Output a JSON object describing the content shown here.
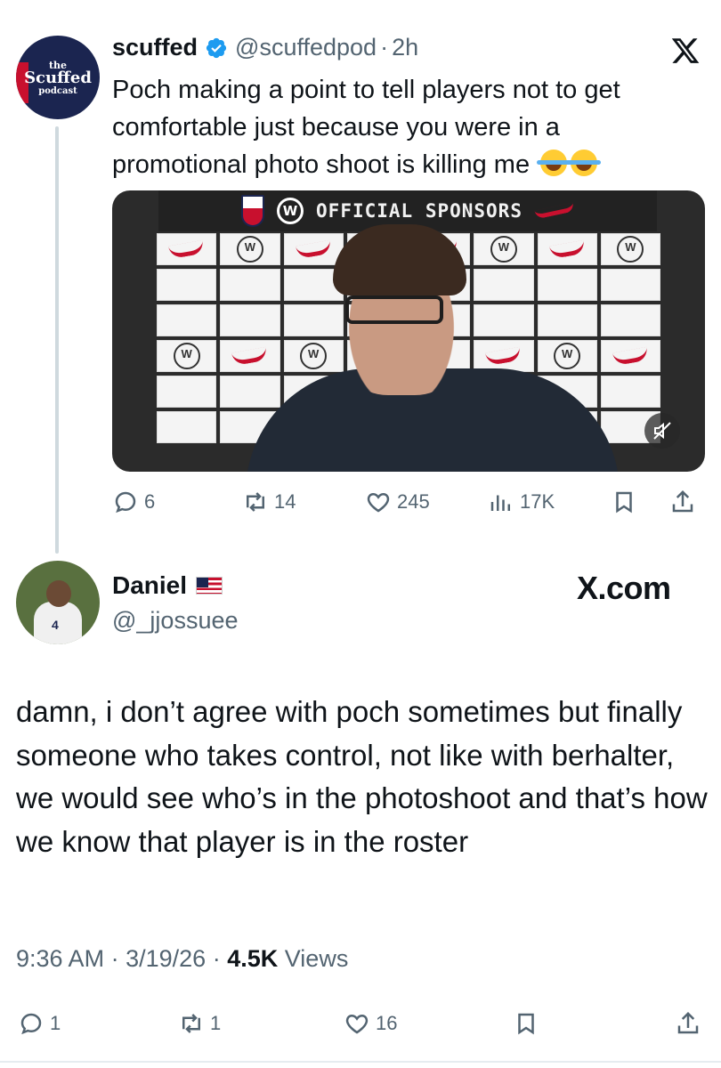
{
  "quoted": {
    "avatar_text": [
      "the",
      "Scuffed",
      "podcast"
    ],
    "name": "scuffed",
    "handle": "@scuffedpod",
    "dot": "·",
    "time": "2h",
    "text": "Poch making a point to tell players not to get comfortable just because you were in a promotional photo shoot is killing me",
    "emoji": [
      "face-with-tears-of-joy",
      "face-with-tears-of-joy"
    ],
    "media": {
      "sponsor_title": "OFFICIAL SPONSORS",
      "vw": "W"
    },
    "stats": {
      "replies": "6",
      "reposts": "14",
      "likes": "245",
      "views": "17K"
    }
  },
  "reply": {
    "name": "Daniel",
    "flag": "us-flag",
    "handle": "@_jjossuee",
    "watermark": "X.com",
    "avatar_jersey_number": "4",
    "text": "damn, i don’t agree with poch sometimes but finally someone who takes control, not like with berhalter, we would see who’s in the photoshoot and that’s how we know that player is in the roster",
    "time": "9:36 AM",
    "dot": "·",
    "date": "3/19/26",
    "views_count": "4.5K",
    "views_label": "Views",
    "stats": {
      "replies": "1",
      "reposts": "1",
      "likes": "16"
    }
  },
  "colors": {
    "text": "#0f1419",
    "muted": "#536471",
    "verified": "#1d9bf0",
    "thread_line": "#cfd9de",
    "brand_red": "#c8102e",
    "navy": "#1b2550"
  }
}
